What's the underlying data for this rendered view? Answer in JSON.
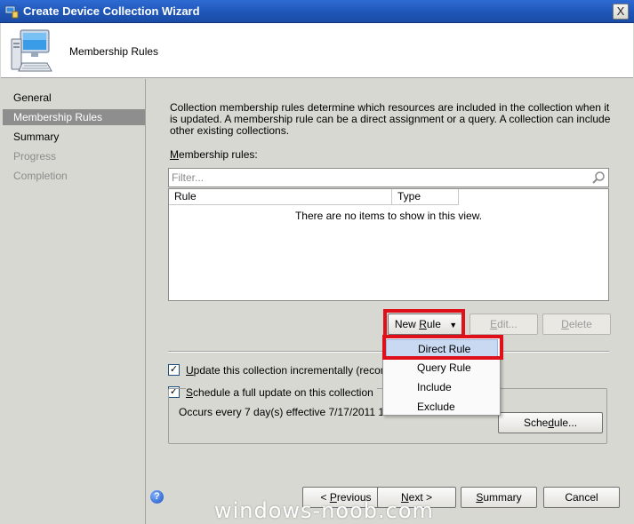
{
  "window": {
    "title": "Create Device Collection Wizard",
    "close_label": "X"
  },
  "header": {
    "page_title": "Membership Rules"
  },
  "nav": {
    "items": [
      {
        "label": "General",
        "state": "normal"
      },
      {
        "label": "Membership Rules",
        "state": "active"
      },
      {
        "label": "Summary",
        "state": "normal"
      },
      {
        "label": "Progress",
        "state": "disabled"
      },
      {
        "label": "Completion",
        "state": "disabled"
      }
    ]
  },
  "main": {
    "description": "Collection membership rules determine which resources are included in the collection when it is updated. A membership rule can be a direct assignment or a query. A collection can include other existing collections.",
    "rules_label": {
      "mnemonic": "M",
      "rest": "embership rules:"
    },
    "filter_placeholder": "Filter...",
    "list": {
      "columns": [
        "Rule",
        "Type"
      ],
      "empty_text": "There are no items to show in this view."
    },
    "buttons": {
      "new_rule": {
        "before": "New ",
        "mnemonic": "R",
        "after": "ule",
        "arrow": "▼"
      },
      "edit": {
        "mnemonic": "E",
        "after": "dit..."
      },
      "delete": {
        "mnemonic": "D",
        "after": "elete"
      }
    },
    "incremental": {
      "mnemonic": "U",
      "rest": "pdate this collection incrementally (recommend",
      "checked_mark": "✓"
    },
    "full_update": {
      "mnemonic": "S",
      "rest": "chedule a full update on this collection",
      "checked_mark": "✓"
    },
    "schedule_text": "Occurs every 7 day(s) effective 7/17/2011 1:12 A",
    "schedule_button": {
      "before": "Sche",
      "mnemonic": "d",
      "after": "ule..."
    }
  },
  "dropdown": {
    "items": [
      "Direct Rule",
      "Query Rule",
      "Include",
      "Exclude"
    ],
    "selected_index": 0
  },
  "footer": {
    "help_glyph": "?",
    "previous": {
      "before": "< ",
      "mnemonic": "P",
      "after": "revious"
    },
    "next": {
      "before": "",
      "mnemonic": "N",
      "after": "ext >"
    },
    "summary": {
      "before": "",
      "mnemonic": "S",
      "after": "ummary"
    },
    "cancel": "Cancel"
  },
  "watermark": "windows-noob.com",
  "colors": {
    "highlight": "#e0101a",
    "title_bar": "#1f56b8",
    "nav_active": "#8e8e8e"
  }
}
